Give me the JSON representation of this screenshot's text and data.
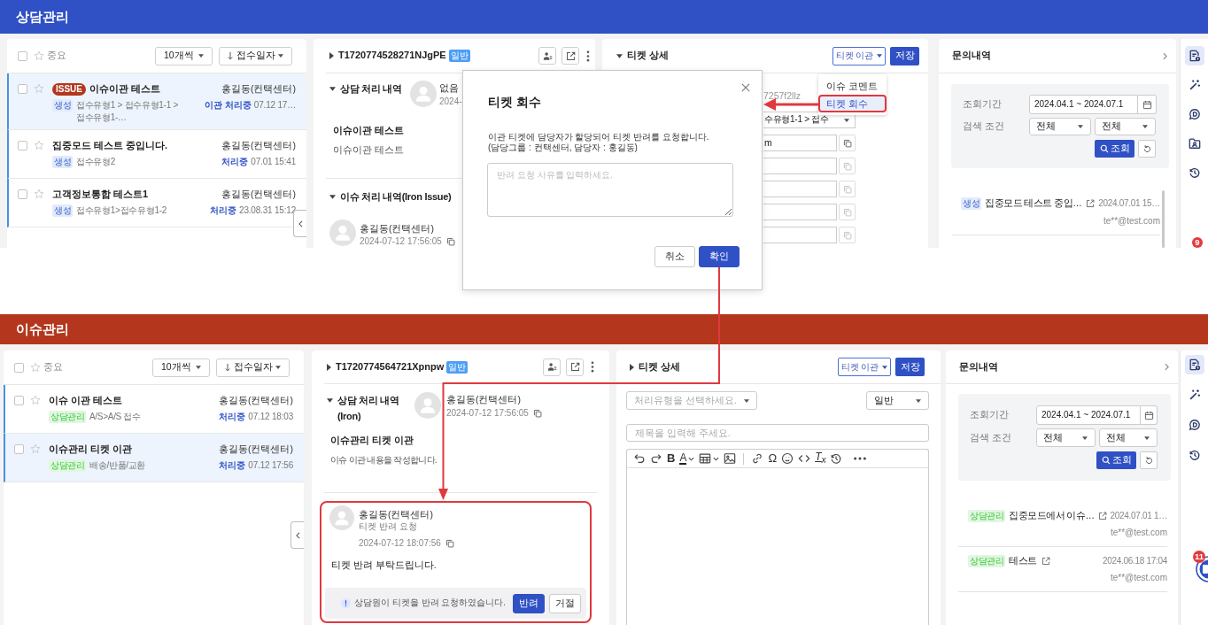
{
  "screens": [
    {
      "header": {
        "title": "상담관리",
        "color": "#2f51c5"
      },
      "ticket_list": {
        "select_all": false,
        "important_label": "중요",
        "page_size": "10개씩",
        "sort": "접수일자",
        "rows": [
          {
            "checked": false,
            "starred": false,
            "selected": true,
            "badge": "ISSUE",
            "title": "이슈이관 테스트",
            "agent": "홍길동(컨택센터)",
            "tag": {
              "text": "생성",
              "color": "#e3eafb"
            },
            "category": "접수유형1 > 접수유형1-1 > 접수유형1-…",
            "status": "이관 처리중",
            "time": "07.12 17…"
          },
          {
            "checked": false,
            "starred": false,
            "selected": false,
            "title": "집중모드 테스트 중입니다.",
            "agent": "홍길동(컨택센터)",
            "tag": {
              "text": "생성",
              "color": "#e3eafb"
            },
            "category": "접수유형2",
            "status": "처리중",
            "time": "07.01 15:41"
          },
          {
            "checked": false,
            "starred": false,
            "selected": false,
            "title": "고객정보통합 테스트1",
            "agent": "홍길동(컨택센터)",
            "tag": {
              "text": "생성",
              "color": "#e3eafb"
            },
            "category": "접수유형1>접수유형1-2",
            "status": "처리중",
            "time": "23.08.31 15:12"
          }
        ]
      },
      "ticket": {
        "expanded": false,
        "id": "T1720774528271NJgPE",
        "type_badge": "일반",
        "counsel_history": {
          "title": "상담 처리 내역",
          "expanded": true,
          "author": "없음",
          "time": "2024-",
          "copyable": false,
          "subject": "이슈이관 테스트",
          "body": "이슈이관 테스트"
        },
        "issue_history": {
          "title": "이슈 처리 내역(Iron Issue)",
          "expanded": true,
          "author": "홍길동(컨택센터)",
          "time": "2024-07-12 17:56:05"
        }
      },
      "detail": {
        "expanded": true,
        "title": "티켓 상세",
        "transfer_button": "티켓 이관",
        "save_button": "저장",
        "menu": [
          {
            "label": "이슈 코멘트",
            "selected": false,
            "highlighted": false
          },
          {
            "label": "티켓 회수",
            "selected": true,
            "highlighted": true
          }
        ],
        "fields": [
          {
            "kind": "text",
            "value": "7257f2llz"
          },
          {
            "kind": "select",
            "value": "수유형1-1 > 접수"
          },
          {
            "kind": "input",
            "value": "m",
            "disabled": false
          },
          {
            "kind": "input",
            "disabled": true
          },
          {
            "kind": "input",
            "disabled": true
          },
          {
            "kind": "input",
            "disabled": true
          },
          {
            "kind": "input",
            "disabled": true
          }
        ]
      },
      "inquiry": {
        "title": "문의내역",
        "period_label": "조회기간",
        "period": "2024.04.1 ~ 2024.07.1",
        "condition_label": "검색 조건",
        "conditions": [
          "전체",
          "전체"
        ],
        "search_button": "조회",
        "items": [
          {
            "tag": {
              "text": "생성",
              "color": "#e3eafb"
            },
            "title": "집중모드 테스트 중입…",
            "time": "2024.07.01 15…",
            "email": "te**@test.com"
          }
        ]
      },
      "sidebar": {
        "icons": [
          {
            "kind": "ticket",
            "selected": true
          },
          {
            "kind": "magic",
            "selected": false
          },
          {
            "kind": "chat",
            "selected": false
          },
          {
            "kind": "contact",
            "selected": false
          },
          {
            "kind": "history",
            "selected": false
          }
        ],
        "badge": "9"
      },
      "dialog": {
        "title": "티켓 회수",
        "message": "이관 티켓에 담당자가 할당되어 티켓 반려를 요청합니다.\n(담당그룹 : 컨택센터, 담당자 : 홍길동)",
        "reason": {
          "placeholder": "반려 요청 사유를 입력하세요."
        },
        "buttons": [
          {
            "label": "취소",
            "kind": "secondary"
          },
          {
            "label": "확인",
            "kind": "primary"
          }
        ]
      }
    },
    {
      "header": {
        "title": "이슈관리",
        "color": "#b3361d"
      },
      "ticket_list": {
        "select_all": false,
        "important_label": "중요",
        "page_size": "10개씩",
        "sort": "접수일자",
        "rows": [
          {
            "checked": false,
            "starred": false,
            "selected": false,
            "title": "이슈 이관 테스트",
            "agent": "홍길동(컨택센터)",
            "tag": {
              "text": "상담관리",
              "color": "#e2f6e2"
            },
            "category": "A/S>A/S 접수",
            "status": "처리중",
            "time": "07.12 18:03"
          },
          {
            "checked": false,
            "starred": false,
            "selected": true,
            "title": "이슈관리 티켓 이관",
            "agent": "홍길동(컨택센터)",
            "tag": {
              "text": "상담관리",
              "color": "#e2f6e2"
            },
            "category": "배송/반품/교환",
            "status": "처리중",
            "time": "07.12 17:56"
          }
        ]
      },
      "ticket": {
        "expanded": false,
        "id": "T1720774564721Xpnpw",
        "type_badge": "일반",
        "counsel_history": {
          "title": "상담 처리 내역 (Iron)",
          "expanded": true,
          "author": "홍길동(컨택센터)",
          "time": "2024-07-12 17:56:05",
          "copyable": true,
          "subject": "이슈관리 티켓 이관",
          "body": "이슈 이관 내용을 작성합니다."
        },
        "return_request": {
          "highlighted": true,
          "author": "홍길동(컨택센터)",
          "action": "티켓 반려 요청",
          "time": "2024-07-12 18:07:56",
          "message": "티켓 반려 부탁드립니다.",
          "notice": "상담원이 티켓을 반려 요청하였습니다.",
          "buttons": [
            {
              "label": "반려",
              "kind": "primary"
            },
            {
              "label": "거절",
              "kind": "secondary"
            }
          ]
        }
      },
      "detail": {
        "expanded": false,
        "title": "티켓 상세",
        "transfer_button": "티켓 이관",
        "save_button": "저장",
        "process_type": {
          "placeholder": "처리유형을 선택하세요."
        },
        "priority": "일반",
        "subject": {
          "placeholder": "제목을 입력해 주세요."
        },
        "toolbar": [
          {
            "kind": "undo"
          },
          {
            "kind": "redo"
          },
          {
            "kind": "bold",
            "text": "B"
          },
          {
            "kind": "font-color",
            "text": "A"
          },
          {
            "kind": "table"
          },
          {
            "kind": "image"
          },
          {
            "kind": "separator"
          },
          {
            "kind": "link"
          },
          {
            "kind": "special-char",
            "text": "Ω"
          },
          {
            "kind": "emoji"
          },
          {
            "kind": "code"
          },
          {
            "kind": "clear-format",
            "text": "T$_{x}$"
          },
          {
            "kind": "history"
          },
          {
            "kind": "more"
          }
        ]
      },
      "inquiry": {
        "title": "문의내역",
        "period_label": "조회기간",
        "period": "2024.04.1 ~ 2024.07.1",
        "condition_label": "검색 조건",
        "conditions": [
          "전체",
          "전체"
        ],
        "search_button": "조회",
        "items": [
          {
            "tag": {
              "text": "상담관리",
              "color": "#e2f6e2"
            },
            "title": "집중모드에서 이슈…",
            "time": "2024.07.01 1…",
            "email": "te**@test.com"
          },
          {
            "tag": {
              "text": "상담관리",
              "color": "#e2f6e2"
            },
            "title": "테스트",
            "time": "2024.06.18 17:04",
            "email": "te**@test.com"
          }
        ]
      },
      "sidebar": {
        "icons": [
          {
            "kind": "ticket",
            "selected": true
          },
          {
            "kind": "magic",
            "selected": false
          },
          {
            "kind": "chat",
            "selected": false
          },
          {
            "kind": "history",
            "selected": false
          }
        ],
        "floating_button": {
          "badge": "11"
        }
      }
    }
  ]
}
